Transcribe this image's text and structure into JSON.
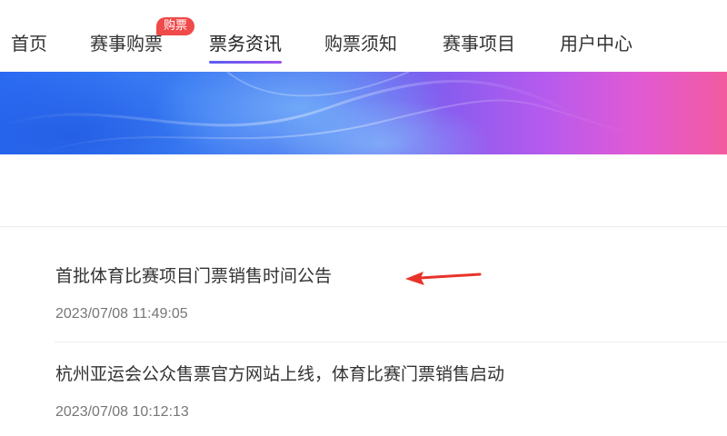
{
  "nav": {
    "items": [
      {
        "label": "首页"
      },
      {
        "label": "赛事购票"
      },
      {
        "label": "票务资讯"
      },
      {
        "label": "购票须知"
      },
      {
        "label": "赛事项目"
      },
      {
        "label": "用户中心"
      }
    ],
    "active_index": 2,
    "badge": "购票"
  },
  "news": [
    {
      "title": "首批体育比赛项目门票销售时间公告",
      "time": "2023/07/08 11:49:05"
    },
    {
      "title": "杭州亚运会公众售票官方网站上线，体育比赛门票销售启动",
      "time": "2023/07/08 10:12:13"
    }
  ],
  "colors": {
    "accent": "#7b5cf0",
    "badge": "#f04a4a",
    "arrow": "#e8332a"
  }
}
